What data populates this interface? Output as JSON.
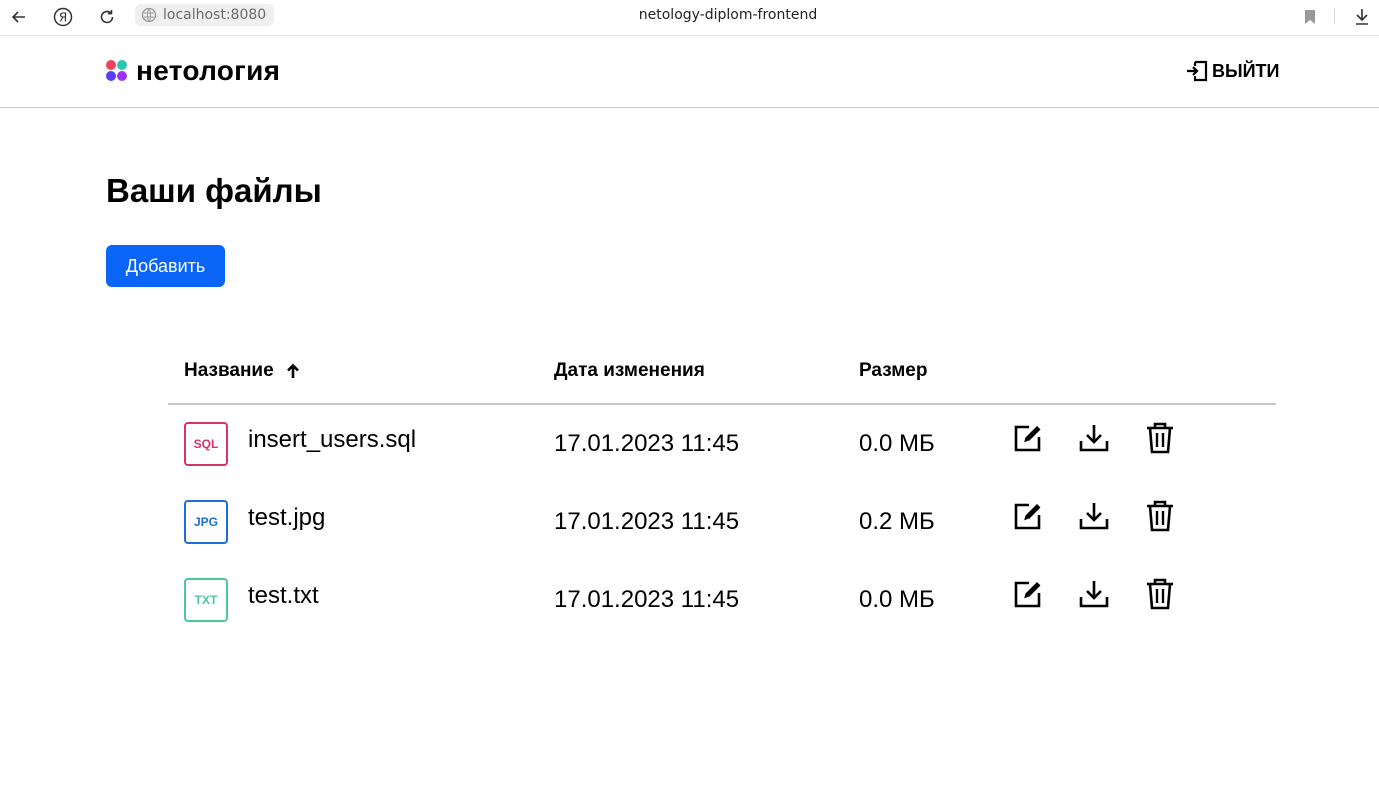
{
  "browser": {
    "address": "localhost:8080",
    "tab_title": "netology-diplom-frontend"
  },
  "header": {
    "logo_text": "нетология",
    "logout_label": "ВЫЙТИ"
  },
  "main": {
    "title": "Ваши файлы",
    "add_button": "Добавить"
  },
  "table": {
    "columns": {
      "name": "Название",
      "date": "Дата изменения",
      "size": "Размер"
    },
    "rows": [
      {
        "type": "SQL",
        "type_color": "#d6336c",
        "name": "insert_users.sql",
        "date": "17.01.2023 11:45",
        "size": "0.0 МБ"
      },
      {
        "type": "JPG",
        "type_color": "#1a6fd8",
        "name": "test.jpg",
        "date": "17.01.2023 11:45",
        "size": "0.2 МБ"
      },
      {
        "type": "TXT",
        "type_color": "#4cc89a",
        "name": "test.txt",
        "date": "17.01.2023 11:45",
        "size": "0.0 МБ"
      }
    ]
  },
  "colors": {
    "accent": "#0a64f5",
    "logo": [
      "#f0415c",
      "#2ec4b6",
      "#5b3cf5",
      "#9b30ff"
    ]
  }
}
